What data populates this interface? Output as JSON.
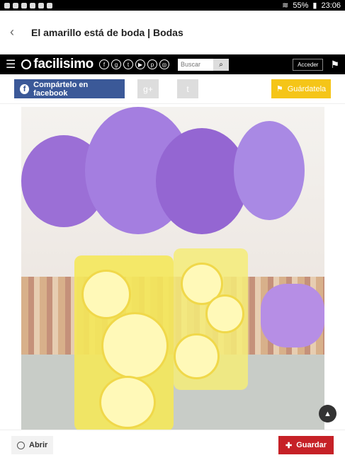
{
  "status_bar": {
    "battery": "55%",
    "time": "23:06"
  },
  "top_bar": {
    "title": "El amarillo está de boda | Bodas"
  },
  "site_header": {
    "logo": "facilisimo",
    "search_placeholder": "Buscar",
    "login_label": "Acceder"
  },
  "share_bar": {
    "facebook_label": "Compártelo en facebook",
    "save_label": "Guárdatela"
  },
  "bottom_bar": {
    "open_label": "Abrir",
    "save_label": "Guardar"
  },
  "colors": {
    "facebook": "#3b5998",
    "save_yellow": "#f5c518",
    "guardar_red": "#c62127"
  }
}
